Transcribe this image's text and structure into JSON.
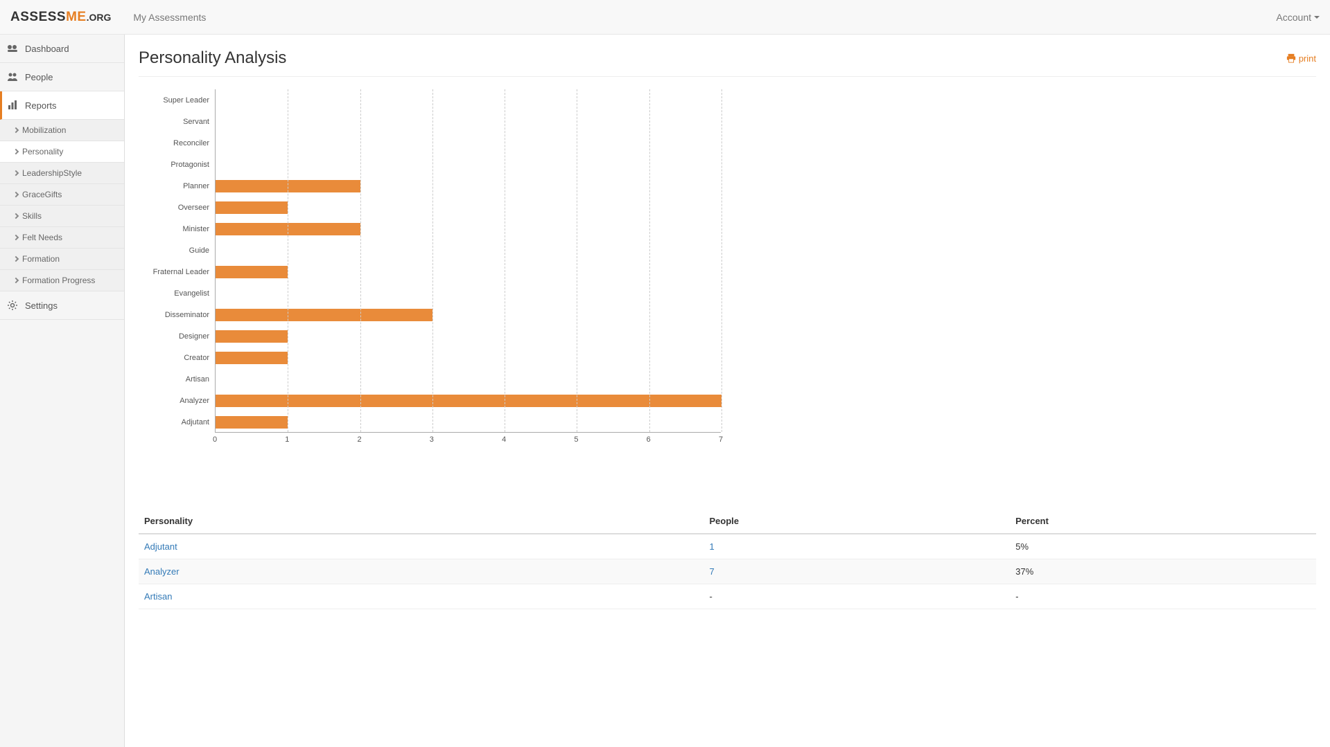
{
  "brand": {
    "assess": "ASSESS",
    "me": "ME",
    "suffix": ".ORG"
  },
  "topnav": {
    "my_assessments": "My Assessments",
    "account": "Account"
  },
  "sidebar": {
    "items": [
      {
        "label": "Dashboard",
        "icon": "dashboard-icon"
      },
      {
        "label": "People",
        "icon": "people-icon"
      },
      {
        "label": "Reports",
        "icon": "reports-icon",
        "active": true
      },
      {
        "label": "Settings",
        "icon": "settings-icon"
      }
    ],
    "reports_sub": [
      {
        "label": "Mobilization"
      },
      {
        "label": "Personality",
        "selected": true
      },
      {
        "label": "LeadershipStyle"
      },
      {
        "label": "GraceGifts"
      },
      {
        "label": "Skills"
      },
      {
        "label": "Felt Needs"
      },
      {
        "label": "Formation"
      },
      {
        "label": "Formation Progress"
      }
    ]
  },
  "page": {
    "title": "Personality Analysis",
    "print": "print"
  },
  "chart_data": {
    "type": "bar",
    "orientation": "horizontal",
    "categories": [
      "Super Leader",
      "Servant",
      "Reconciler",
      "Protagonist",
      "Planner",
      "Overseer",
      "Minister",
      "Guide",
      "Fraternal Leader",
      "Evangelist",
      "Disseminator",
      "Designer",
      "Creator",
      "Artisan",
      "Analyzer",
      "Adjutant"
    ],
    "values": [
      0,
      0,
      0,
      0,
      2,
      1,
      2,
      0,
      1,
      0,
      3,
      1,
      1,
      0,
      7,
      1
    ],
    "xlim": [
      0,
      7
    ],
    "xticks": [
      0,
      1,
      2,
      3,
      4,
      5,
      6,
      7
    ],
    "bar_color": "#e98b3a",
    "title": "",
    "xlabel": "",
    "ylabel": ""
  },
  "table": {
    "headers": {
      "personality": "Personality",
      "people": "People",
      "percent": "Percent"
    },
    "rows": [
      {
        "personality": "Adjutant",
        "people": "1",
        "percent": "5%"
      },
      {
        "personality": "Analyzer",
        "people": "7",
        "percent": "37%"
      },
      {
        "personality": "Artisan",
        "people": "-",
        "percent": "-"
      }
    ]
  },
  "colors": {
    "accent": "#e67e22",
    "link": "#337ab7"
  }
}
